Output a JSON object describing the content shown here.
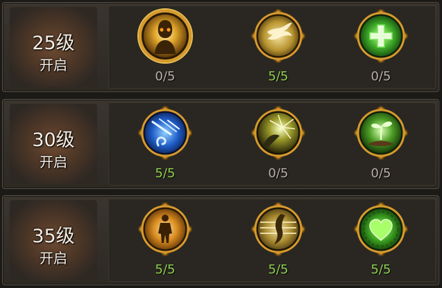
{
  "rows": [
    {
      "level": "25级",
      "status": "开启",
      "skills": [
        {
          "icon": "golden-warrior-icon",
          "count": "0/5",
          "count_color": "#b8b1a6",
          "selected": true
        },
        {
          "icon": "golden-bird-icon",
          "count": "5/5",
          "count_color": "#8fd14f"
        },
        {
          "icon": "green-heal-cross-icon",
          "count": "0/5",
          "count_color": "#b8b1a6"
        }
      ]
    },
    {
      "level": "30级",
      "status": "开启",
      "skills": [
        {
          "icon": "blue-meteor-icon",
          "count": "5/5",
          "count_color": "#8fd14f"
        },
        {
          "icon": "light-burst-icon",
          "count": "0/5",
          "count_color": "#b8b1a6"
        },
        {
          "icon": "green-sprout-icon",
          "count": "0/5",
          "count_color": "#b8b1a6"
        }
      ]
    },
    {
      "level": "35级",
      "status": "开启",
      "skills": [
        {
          "icon": "golden-figure-icon",
          "count": "5/5",
          "count_color": "#8fd14f"
        },
        {
          "icon": "golden-feather-icon",
          "count": "5/5",
          "count_color": "#8fd14f"
        },
        {
          "icon": "green-heart-icon",
          "count": "5/5",
          "count_color": "#8fd14f"
        }
      ]
    }
  ]
}
